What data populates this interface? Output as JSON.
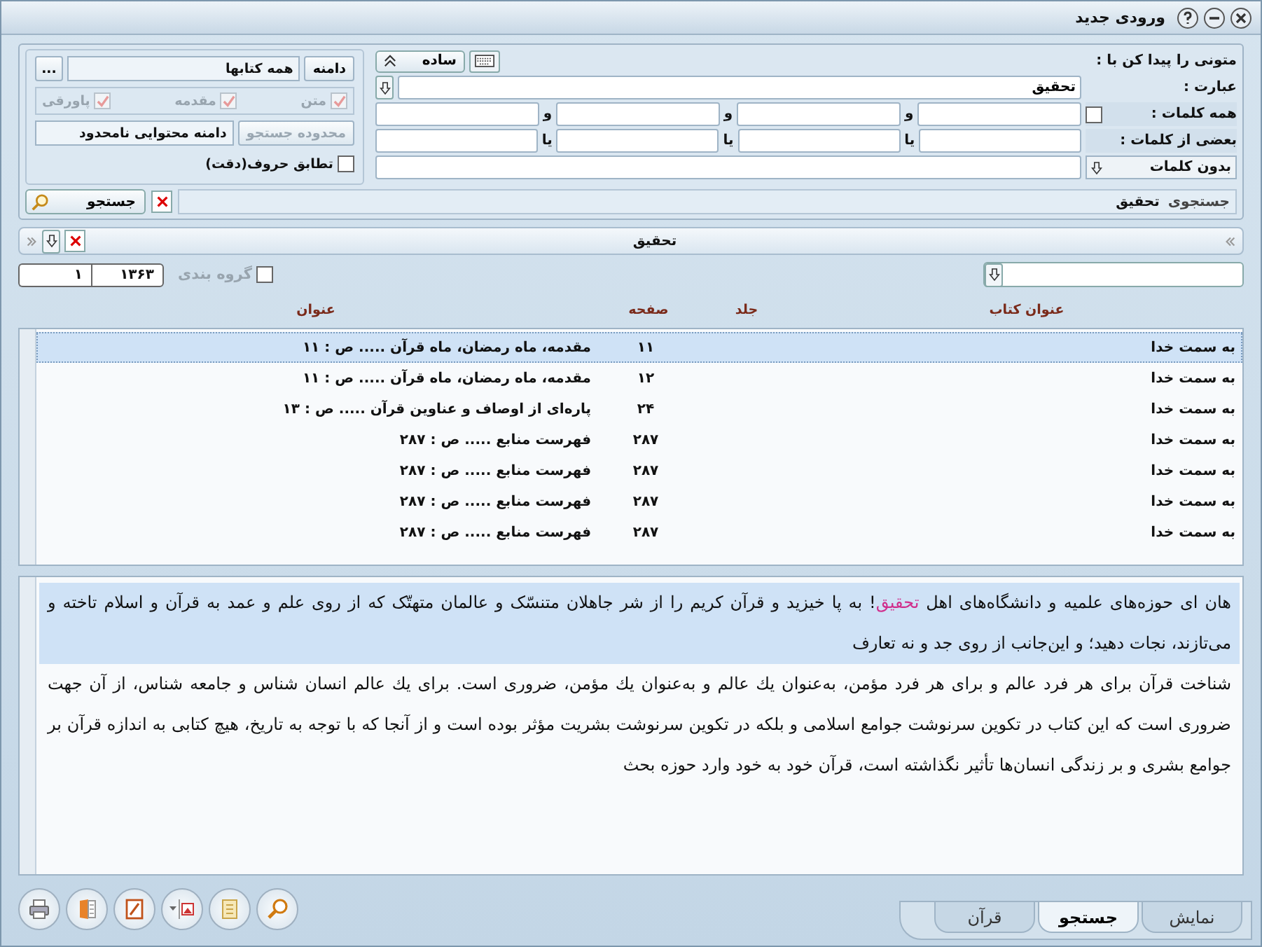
{
  "window": {
    "title": "ورودی جدید"
  },
  "search_form": {
    "heading": "متونی را پیدا کن با :",
    "mode_button": "ساده",
    "phrase": {
      "label": "عبارت :",
      "value": "تحقیق"
    },
    "all_words": {
      "label": "همه کلمات :",
      "checked": false,
      "separators": [
        "و",
        "و",
        "و"
      ]
    },
    "some_words": {
      "label": "بعضی از کلمات :",
      "separators": [
        "یا",
        "یا",
        "یا"
      ]
    },
    "without_words": {
      "dropdown": "بدون کلمات"
    },
    "query": {
      "label": "جستجوی",
      "value": "تحقیق"
    },
    "search_button": "جستجو"
  },
  "scope_panel": {
    "scope_button": "دامنه",
    "scope_value": "همه کتابها",
    "browse_button": "...",
    "sections": [
      {
        "label": "متن",
        "checked": true,
        "disabled": true
      },
      {
        "label": "مقدمه",
        "checked": true,
        "disabled": true
      },
      {
        "label": "پاورقی",
        "checked": true,
        "disabled": true
      }
    ],
    "range_button": {
      "label": "محدوده جستجو",
      "disabled": true
    },
    "range_value": "دامنه محتوایی نامحدود",
    "exact_match": {
      "label": "تطابق حروف(دقت)",
      "checked": false
    }
  },
  "results": {
    "title": "تحقیق",
    "group_by": {
      "label": "گروه بندی",
      "checked": false
    },
    "year": "۱۳۶۳",
    "page": "۱",
    "columns": [
      "عنوان کتاب",
      "جلد",
      "صفحه",
      "عنوان"
    ],
    "rows": [
      {
        "book": "به سمت خدا",
        "page": "۱۱",
        "title": "مقدمه، ماه رمضان، ماه قرآن ..... ص : ۱۱",
        "selected": true
      },
      {
        "book": "به سمت خدا",
        "page": "۱۲",
        "title": "مقدمه، ماه رمضان، ماه قرآن ..... ص : ۱۱",
        "selected": false
      },
      {
        "book": "به سمت خدا",
        "page": "۲۴",
        "title": "پاره‌ای از اوصاف و عناوین قرآن ..... ص : ۱۳",
        "selected": false
      },
      {
        "book": "به سمت خدا",
        "page": "۲۸۷",
        "title": "فهرست منابع ..... ص : ۲۸۷",
        "selected": false
      },
      {
        "book": "به سمت خدا",
        "page": "۲۸۷",
        "title": "فهرست منابع ..... ص : ۲۸۷",
        "selected": false
      },
      {
        "book": "به سمت خدا",
        "page": "۲۸۷",
        "title": "فهرست منابع ..... ص : ۲۸۷",
        "selected": false
      },
      {
        "book": "به سمت خدا",
        "page": "۲۸۷",
        "title": "فهرست منابع ..... ص : ۲۸۷",
        "selected": false
      }
    ]
  },
  "passage": {
    "paragraphs": [
      {
        "selected": true,
        "parts": [
          {
            "text": "هان ای حوزه‌های علمیه و دانشگاه‌های اهل ",
            "highlight": false
          },
          {
            "text": "تحقیق",
            "highlight": true
          },
          {
            "text": "! به پا خیزید و قرآن کریم را از شر جاهلان متنسّک و عالمان متهتّک که از روی علم و عمد به قرآن و اسلام تاخته و می‌تازند، نجات دهید؛ و این‌جانب از روی جد و نه تعارف",
            "highlight": false
          }
        ]
      },
      {
        "selected": false,
        "parts": [
          {
            "text": "شناخت قرآن برای هر فرد عالم و برای هر فرد مؤمن، به‌عنوان یك عالم و به‌عنوان یك مؤمن، ضروری است. برای یك عالم انسان شناس و جامعه شناس، از آن جهت ضروری است که این کتاب در تکوین سرنوشت جوامع اسلامی و بلکه در تکوین سرنوشت بشریت مؤثر بوده است و از آنجا که با توجه به تاریخ، هیچ کتابی به اندازه قرآن بر جوامع بشری و بر زندگی انسان‌ها تأثیر نگذاشته است، قرآن خود به خود وارد حوزه بحث",
            "highlight": false
          }
        ]
      }
    ]
  },
  "tabs": [
    {
      "label": "نمایش",
      "selected": false
    },
    {
      "label": "جستجو",
      "selected": true
    },
    {
      "label": "قرآن",
      "selected": false
    }
  ]
}
